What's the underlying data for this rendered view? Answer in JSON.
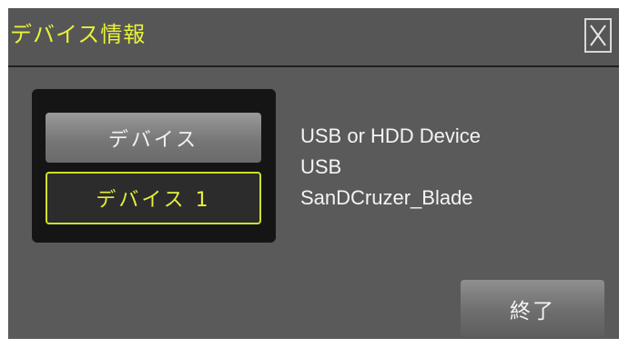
{
  "window": {
    "title": "デバイス情報",
    "close_label": "X"
  },
  "device_list": {
    "header_button": "デバイス",
    "selected_item": "デバイス 1"
  },
  "device_info": {
    "lines": [
      "USB or HDD Device",
      "USB",
      "SanDCruzer_Blade"
    ]
  },
  "footer": {
    "exit_label": "終了"
  },
  "colors": {
    "accent": "#e8f23a",
    "background": "#5a5a5a",
    "panel": "#151515"
  }
}
